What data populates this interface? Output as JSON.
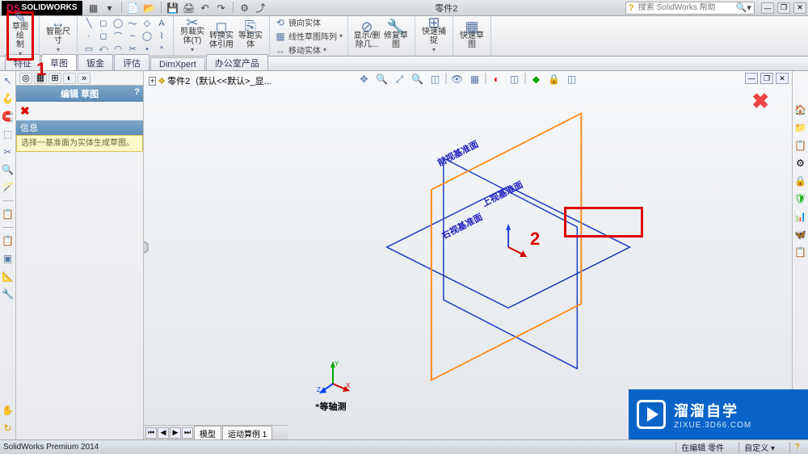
{
  "app": {
    "name": "SOLIDWORKS",
    "logo_prefix": "DS"
  },
  "titlebar": {
    "doc_title": "零件2",
    "search_placeholder": "搜索 SolidWorks 帮助",
    "win": {
      "min": "—",
      "restore": "❐",
      "close": "✕"
    }
  },
  "quick_access": [
    "▦",
    "▾",
    "📄",
    "📂",
    "💾",
    "🖨",
    "↶",
    "↷",
    "⚙",
    "⤴"
  ],
  "ribbon": {
    "sketch": {
      "label": "草图绘\n制",
      "icon": "✎"
    },
    "smart_dim": {
      "label": "智能尺\n寸",
      "icon": "↔"
    },
    "shape_grid": [
      "╲",
      "◻",
      "◯",
      "〜",
      "◇",
      "A",
      "·",
      "◻",
      "⌒",
      "⌢",
      "◯",
      "⌇",
      "▭",
      "⤺",
      "◠",
      "✂",
      "•",
      "*"
    ],
    "convert": {
      "label": "剪裁实\n体(T)",
      "icon": "✂"
    },
    "convert2": {
      "label": "转换实\n体引用",
      "icon": "◻"
    },
    "offset": {
      "label": "等距实\n体",
      "icon": "⎘"
    },
    "mirror": "镜向实体",
    "pattern": "线性草图阵列",
    "move": "移动实体",
    "showdel": {
      "label": "显示/删\n除几...",
      "icon": "⊘"
    },
    "repair": {
      "label": "修复草\n图",
      "icon": "🔧"
    },
    "quickgrab": {
      "label": "快速捕\n捉",
      "icon": "⊞"
    },
    "quicksketch": {
      "label": "快速草\n图",
      "icon": "▦"
    }
  },
  "tabs": [
    "特征",
    "草图",
    "钣金",
    "评估",
    "DimXpert",
    "办公室产品"
  ],
  "panel": {
    "header": "编辑 草图",
    "info_head": "信息",
    "info_body": "选择一基准面为实体生成草图。"
  },
  "breadcrumb": "零件2（默认<<默认>_显...",
  "viewport_icons": [
    "✥",
    "🔍",
    "⤢",
    "🔍",
    "◫",
    "👁",
    "▦",
    "◐",
    "◫",
    "◆",
    "🔒",
    "◫"
  ],
  "planes": {
    "front": "前视基准面",
    "top": "上视基准面",
    "right": "右视基准面"
  },
  "annotations": {
    "n1": "1",
    "n2": "2"
  },
  "triad_label": "*等轴测",
  "bottom_tabs": {
    "nav": [
      "⏮",
      "◀",
      "▶",
      "⏭"
    ],
    "tabs": [
      "模型",
      "运动算例 1"
    ]
  },
  "statusbar": {
    "left": "SolidWorks Premium 2014",
    "mode": "在编辑 零件",
    "custom": "自定义 ▾",
    "help": "?"
  },
  "right_tools": [
    "🏠",
    "📁",
    "📋",
    "⚙",
    "🔒",
    "🛡",
    "📊",
    "🦋",
    "📋"
  ],
  "left_tools_top": [
    "↖",
    "🪝",
    "🧲",
    "⬚",
    "✂",
    "🔍",
    "🪄"
  ],
  "left_tools_mid": [
    "📋",
    "📋",
    "▣",
    "📐",
    "🔧"
  ],
  "left_tools_bot": [
    "✋",
    "↻"
  ],
  "panel_icons": [
    "◎",
    "▦",
    "⊞",
    "◐",
    "»"
  ],
  "watermark": {
    "t1": "溜溜自学",
    "t2": "ZIXUE.3D66.COM"
  }
}
